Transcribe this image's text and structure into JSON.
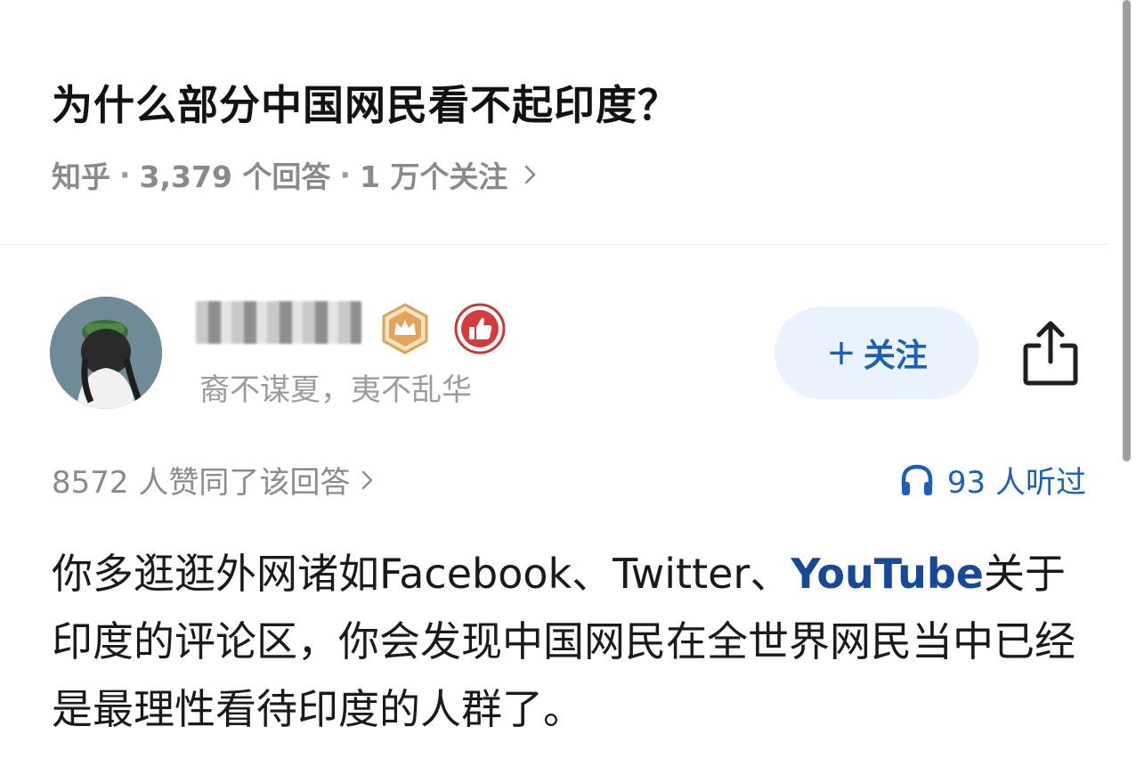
{
  "question": {
    "title": "为什么部分中国网民看不起印度？",
    "source": "知乎",
    "answer_count": "3,379 个回答",
    "follower_count": "1 万个关注"
  },
  "author": {
    "bio": "裔不谋夏，夷不乱华",
    "follow_label": "关注"
  },
  "stats": {
    "votes": "8572 人赞同了该回答",
    "listeners": "93 人听过"
  },
  "answer": {
    "part1": "你多逛逛外网诸如Facebook、Twitter、",
    "link": "YouTube",
    "part2": "关于印度的评论区，你会发现中国网民在全世界网民当中已经是最理性看待印度的人群了。"
  },
  "icons": {
    "meta_chevron": "chevron-right-icon",
    "crown_badge": "crown-badge-icon",
    "thumb_badge": "thumbs-up-badge-icon",
    "share": "share-icon",
    "headphones": "headphones-icon"
  },
  "colors": {
    "accent": "#1b5fb8",
    "follow_bg": "#eaf2fd",
    "link": "#174a96",
    "muted": "#8a8a8a"
  }
}
